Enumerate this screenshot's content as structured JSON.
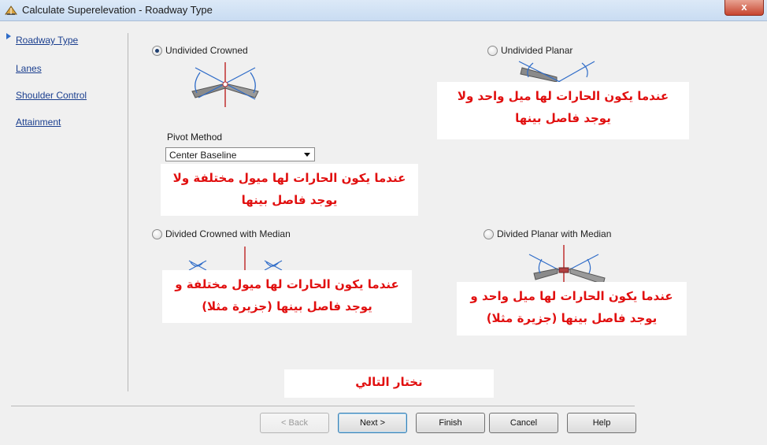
{
  "window": {
    "title": "Calculate Superelevation - Roadway Type",
    "close_glyph": "x"
  },
  "nav": {
    "items": [
      {
        "label": "Roadway Type"
      },
      {
        "label": "Lanes"
      },
      {
        "label": "Shoulder Control"
      },
      {
        "label": "Attainment"
      }
    ]
  },
  "options": {
    "undivided_crowned": {
      "label": "Undivided Crowned",
      "selected": true
    },
    "undivided_planar": {
      "label": "Undivided Planar",
      "selected": false
    },
    "divided_crowned_median": {
      "label": "Divided Crowned with Median",
      "selected": false
    },
    "divided_planar_median": {
      "label": "Divided Planar with Median",
      "selected": false
    }
  },
  "pivot": {
    "label": "Pivot Method",
    "value": "Center Baseline"
  },
  "notes": {
    "undivided_planar_line1": "عندما يكون الحارات لها ميل واحد ولا",
    "undivided_planar_line2": "يوجد فاصل بينها",
    "undivided_crowned_line1": "عندما يكون الحارات لها ميول مختلفة ولا",
    "undivided_crowned_line2": "يوجد فاصل بينها",
    "divided_crowned_line1": "عندما يكون الحارات لها ميول مختلفة و",
    "divided_crowned_line2": "يوجد فاصل بينها (جزيرة مثلا)",
    "divided_planar_line1": "عندما يكون الحارات لها ميل واحد و",
    "divided_planar_line2": "يوجد فاصل بينها (جزيرة مثلا)",
    "next_hint": "نختار التالي"
  },
  "buttons": {
    "back": "< Back",
    "next": "Next >",
    "finish": "Finish",
    "cancel": "Cancel",
    "help": "Help"
  }
}
